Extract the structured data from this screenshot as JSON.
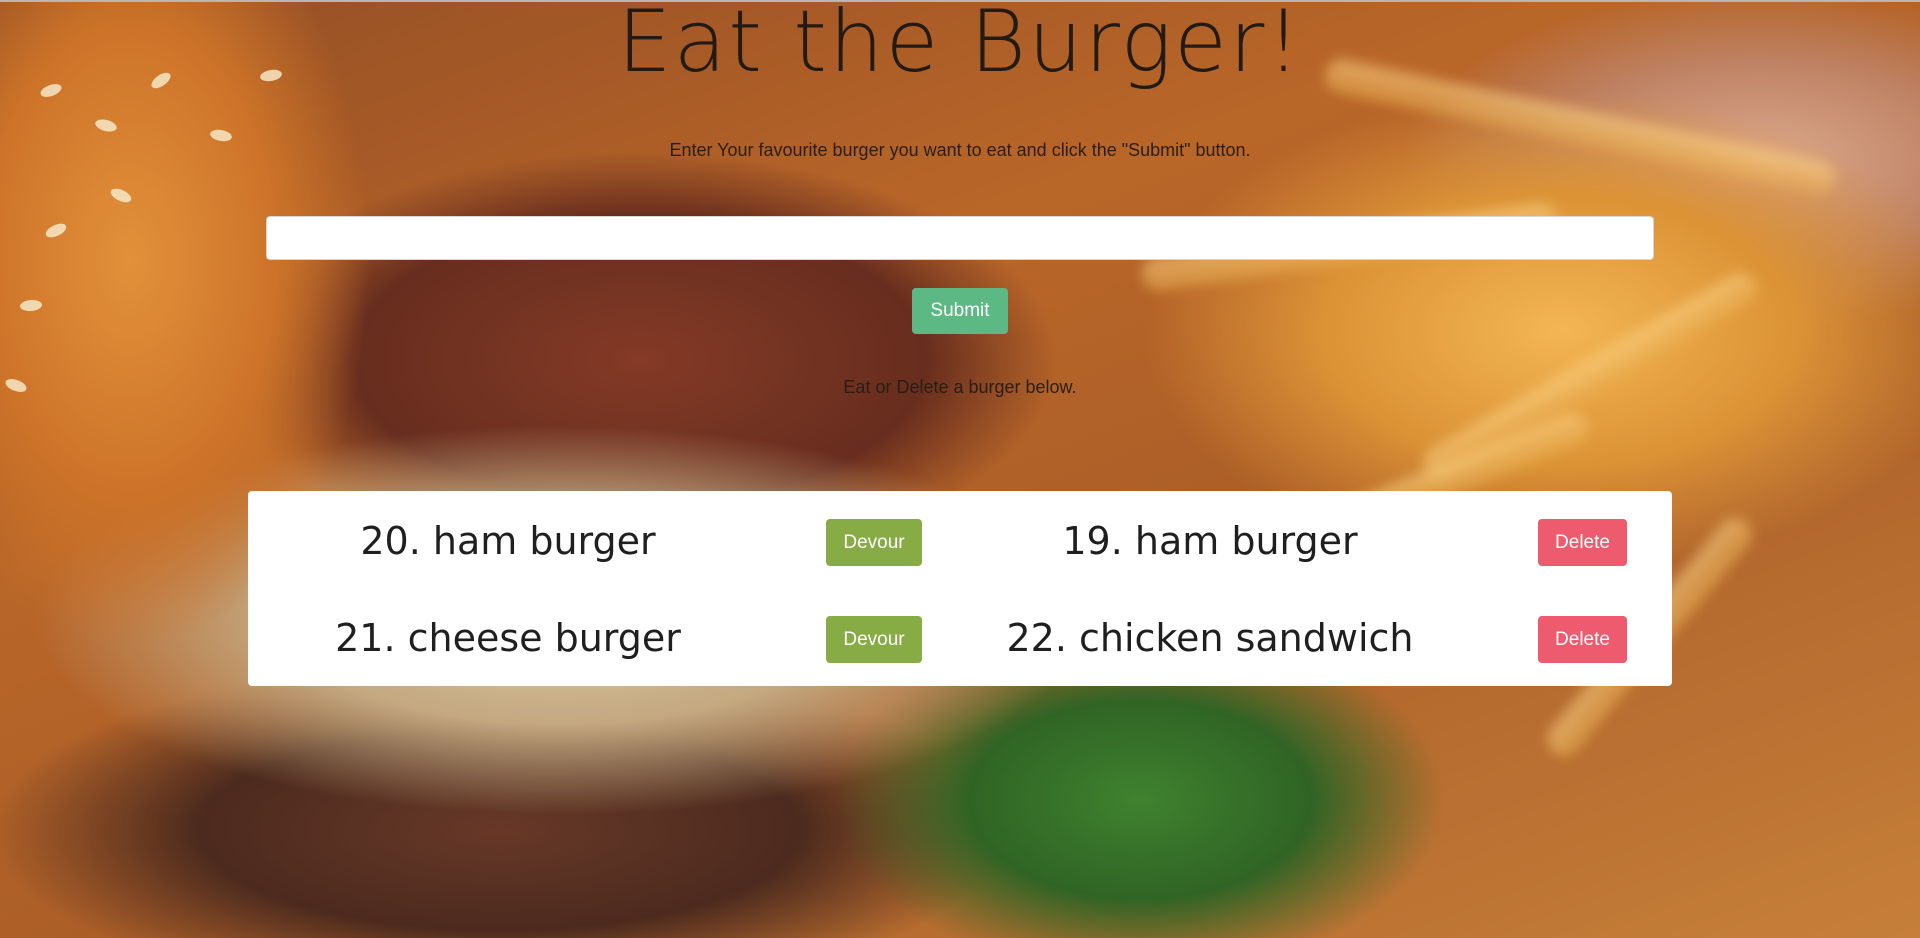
{
  "page": {
    "title": "Eat the Burger!",
    "subtitle": "Enter Your favourite burger you want to eat and click the \"Submit\" button.",
    "instruction": "Eat or Delete a burger below."
  },
  "form": {
    "input_value": "",
    "submit_label": "Submit"
  },
  "uneaten": [
    {
      "name": "20. ham burger",
      "action_label": "Devour"
    },
    {
      "name": "21. cheese burger",
      "action_label": "Devour"
    }
  ],
  "eaten": [
    {
      "name": "19. ham burger",
      "action_label": "Delete"
    },
    {
      "name": "22. chicken sandwich",
      "action_label": "Delete"
    }
  ],
  "colors": {
    "submit": "#5cb984",
    "devour": "#87ac45",
    "delete": "#ee5a6e",
    "panel": "#ffffff"
  },
  "background": {
    "image": "burger-and-fries-photo"
  }
}
